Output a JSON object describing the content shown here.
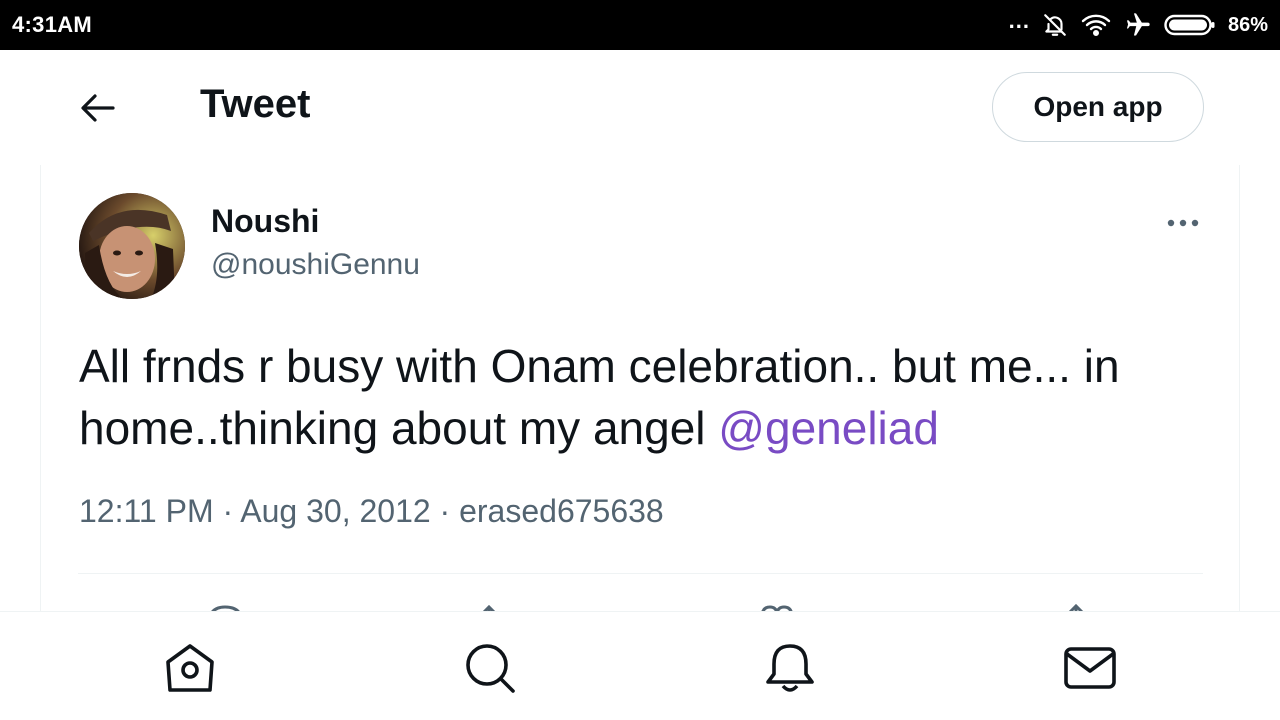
{
  "status_bar": {
    "time": "4:31AM",
    "more_indicator": "...",
    "icons": [
      "notifications-off-icon",
      "wifi-icon",
      "airplane-mode-icon",
      "battery-icon"
    ],
    "battery_percent": "86%"
  },
  "header": {
    "title": "Tweet",
    "open_app_label": "Open app"
  },
  "tweet": {
    "author": {
      "name": "Noushi",
      "handle": "@noushiGennu"
    },
    "text_plain": "All frnds r busy with Onam celebration.. but me... in home..thinking about my angel ",
    "mention": "@geneliad",
    "meta": "12:11 PM · Aug 30, 2012 · erased675638"
  },
  "colors": {
    "mention": "#794bc4",
    "secondary_text": "#536471",
    "border": "#eff3f4"
  },
  "bottom_nav": {
    "items": [
      "home-icon",
      "search-icon",
      "notifications-icon",
      "messages-icon"
    ]
  }
}
